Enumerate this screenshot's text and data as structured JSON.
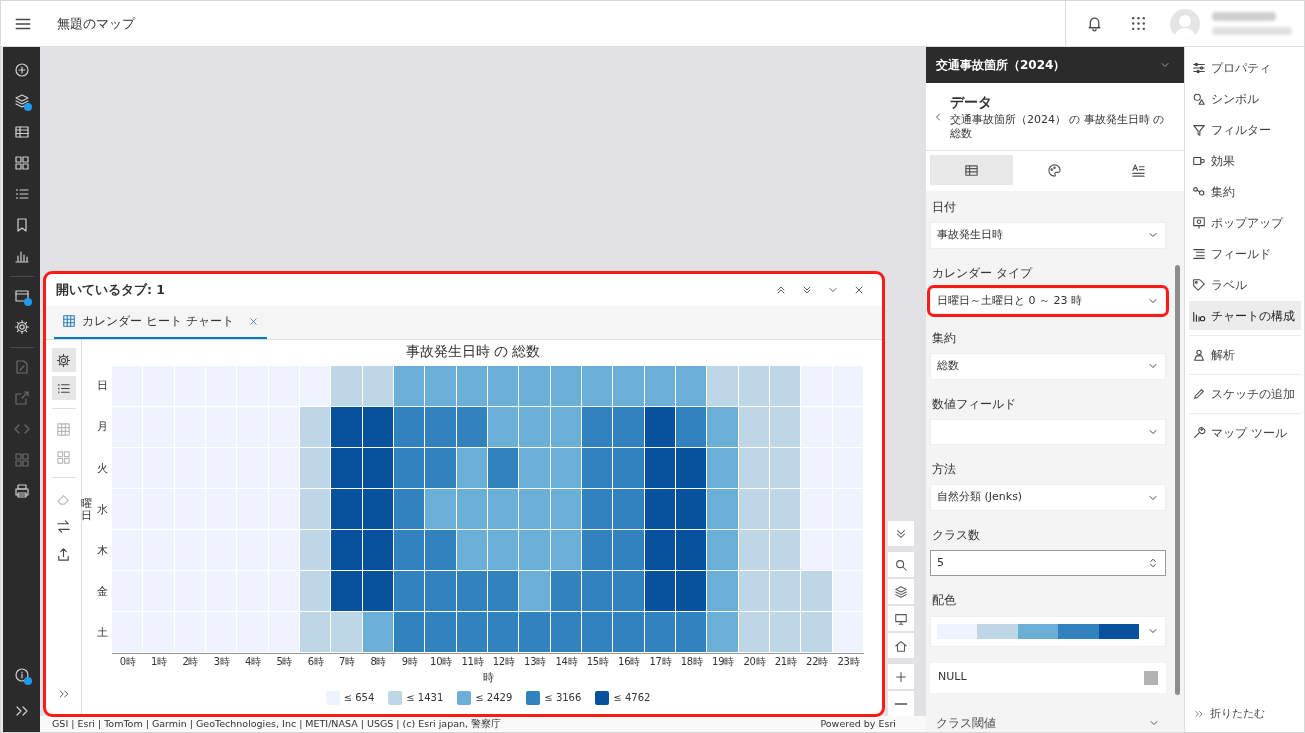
{
  "top_bar": {
    "title": "無題のマップ"
  },
  "left_rail": {
    "groups": [
      [
        {
          "badge": false,
          "disabled": false
        },
        {
          "badge": true,
          "disabled": false
        },
        {
          "badge": false,
          "disabled": false
        },
        {
          "badge": false,
          "disabled": false
        },
        {
          "badge": false,
          "disabled": false
        },
        {
          "badge": false,
          "disabled": false
        },
        {
          "badge": false,
          "disabled": false
        }
      ],
      [
        {
          "badge": true,
          "disabled": false
        },
        {
          "badge": false,
          "disabled": false
        }
      ],
      [
        {
          "badge": false,
          "disabled": true
        },
        {
          "badge": false,
          "disabled": true
        },
        {
          "badge": false,
          "disabled": true
        },
        {
          "badge": false,
          "disabled": true
        },
        {
          "badge": false,
          "disabled": false
        }
      ]
    ],
    "bottom": [
      {
        "badge": true,
        "disabled": false
      },
      {
        "badge": false,
        "disabled": false
      }
    ]
  },
  "map": {
    "attribution": "GSI | Esri | TomTom | Garmin | GeoTechnologies, Inc | METI/NASA | USGS | (c) Esri japan, 警察庁",
    "powered_by": "Powered by Esri"
  },
  "chart_panel": {
    "highlighted": true,
    "title": "開いているタブ: 1",
    "tabs": [
      {
        "label": "カレンダー ヒート チャート",
        "selected": true
      }
    ],
    "tools": [
      [
        {
          "selected": true,
          "disabled": false
        },
        {
          "selected": true,
          "disabled": false
        }
      ],
      [
        {
          "selected": false,
          "disabled": true
        },
        {
          "selected": false,
          "disabled": true
        }
      ],
      [
        {
          "selected": false,
          "disabled": true
        },
        {
          "selected": false,
          "disabled": false
        },
        {
          "selected": false,
          "disabled": false
        }
      ]
    ],
    "chart": {
      "title": "事故発生日時 の 総数",
      "ylabel": "曜日",
      "xlabel": "時",
      "columns": [
        "0時",
        "1時",
        "2時",
        "3時",
        "4時",
        "5時",
        "6時",
        "7時",
        "8時",
        "9時",
        "10時",
        "11時",
        "12時",
        "13時",
        "14時",
        "15時",
        "16時",
        "17時",
        "18時",
        "19時",
        "20時",
        "21時",
        "22時",
        "23時"
      ],
      "rows": [
        {
          "label": "日",
          "cells": [
            {
              "color": "#eff3ff"
            },
            {
              "color": "#eff3ff"
            },
            {
              "color": "#eff3ff"
            },
            {
              "color": "#eff3ff"
            },
            {
              "color": "#eff3ff"
            },
            {
              "color": "#eff3ff"
            },
            {
              "color": "#eff3ff"
            },
            {
              "color": "#bdd7e7"
            },
            {
              "color": "#bdd7e7"
            },
            {
              "color": "#6baed6"
            },
            {
              "color": "#6baed6"
            },
            {
              "color": "#6baed6"
            },
            {
              "color": "#6baed6"
            },
            {
              "color": "#6baed6"
            },
            {
              "color": "#6baed6"
            },
            {
              "color": "#6baed6"
            },
            {
              "color": "#6baed6"
            },
            {
              "color": "#6baed6"
            },
            {
              "color": "#6baed6"
            },
            {
              "color": "#bdd7e7"
            },
            {
              "color": "#bdd7e7"
            },
            {
              "color": "#bdd7e7"
            },
            {
              "color": "#eff3ff"
            },
            {
              "color": "#eff3ff"
            }
          ]
        },
        {
          "label": "月",
          "cells": [
            {
              "color": "#eff3ff"
            },
            {
              "color": "#eff3ff"
            },
            {
              "color": "#eff3ff"
            },
            {
              "color": "#eff3ff"
            },
            {
              "color": "#eff3ff"
            },
            {
              "color": "#eff3ff"
            },
            {
              "color": "#bdd7e7"
            },
            {
              "color": "#08519c"
            },
            {
              "color": "#08519c"
            },
            {
              "color": "#3182bd"
            },
            {
              "color": "#3182bd"
            },
            {
              "color": "#3182bd"
            },
            {
              "color": "#6baed6"
            },
            {
              "color": "#6baed6"
            },
            {
              "color": "#6baed6"
            },
            {
              "color": "#3182bd"
            },
            {
              "color": "#3182bd"
            },
            {
              "color": "#08519c"
            },
            {
              "color": "#3182bd"
            },
            {
              "color": "#6baed6"
            },
            {
              "color": "#bdd7e7"
            },
            {
              "color": "#bdd7e7"
            },
            {
              "color": "#eff3ff"
            },
            {
              "color": "#eff3ff"
            }
          ]
        },
        {
          "label": "火",
          "cells": [
            {
              "color": "#eff3ff"
            },
            {
              "color": "#eff3ff"
            },
            {
              "color": "#eff3ff"
            },
            {
              "color": "#eff3ff"
            },
            {
              "color": "#eff3ff"
            },
            {
              "color": "#eff3ff"
            },
            {
              "color": "#bdd7e7"
            },
            {
              "color": "#08519c"
            },
            {
              "color": "#08519c"
            },
            {
              "color": "#3182bd"
            },
            {
              "color": "#3182bd"
            },
            {
              "color": "#6baed6"
            },
            {
              "color": "#3182bd"
            },
            {
              "color": "#6baed6"
            },
            {
              "color": "#6baed6"
            },
            {
              "color": "#3182bd"
            },
            {
              "color": "#3182bd"
            },
            {
              "color": "#08519c"
            },
            {
              "color": "#08519c"
            },
            {
              "color": "#6baed6"
            },
            {
              "color": "#bdd7e7"
            },
            {
              "color": "#bdd7e7"
            },
            {
              "color": "#eff3ff"
            },
            {
              "color": "#eff3ff"
            }
          ]
        },
        {
          "label": "水",
          "cells": [
            {
              "color": "#eff3ff"
            },
            {
              "color": "#eff3ff"
            },
            {
              "color": "#eff3ff"
            },
            {
              "color": "#eff3ff"
            },
            {
              "color": "#eff3ff"
            },
            {
              "color": "#eff3ff"
            },
            {
              "color": "#bdd7e7"
            },
            {
              "color": "#08519c"
            },
            {
              "color": "#08519c"
            },
            {
              "color": "#3182bd"
            },
            {
              "color": "#6baed6"
            },
            {
              "color": "#6baed6"
            },
            {
              "color": "#6baed6"
            },
            {
              "color": "#6baed6"
            },
            {
              "color": "#6baed6"
            },
            {
              "color": "#3182bd"
            },
            {
              "color": "#3182bd"
            },
            {
              "color": "#08519c"
            },
            {
              "color": "#08519c"
            },
            {
              "color": "#6baed6"
            },
            {
              "color": "#bdd7e7"
            },
            {
              "color": "#bdd7e7"
            },
            {
              "color": "#eff3ff"
            },
            {
              "color": "#eff3ff"
            }
          ]
        },
        {
          "label": "木",
          "cells": [
            {
              "color": "#eff3ff"
            },
            {
              "color": "#eff3ff"
            },
            {
              "color": "#eff3ff"
            },
            {
              "color": "#eff3ff"
            },
            {
              "color": "#eff3ff"
            },
            {
              "color": "#eff3ff"
            },
            {
              "color": "#bdd7e7"
            },
            {
              "color": "#08519c"
            },
            {
              "color": "#08519c"
            },
            {
              "color": "#3182bd"
            },
            {
              "color": "#3182bd"
            },
            {
              "color": "#6baed6"
            },
            {
              "color": "#6baed6"
            },
            {
              "color": "#6baed6"
            },
            {
              "color": "#6baed6"
            },
            {
              "color": "#3182bd"
            },
            {
              "color": "#3182bd"
            },
            {
              "color": "#08519c"
            },
            {
              "color": "#08519c"
            },
            {
              "color": "#6baed6"
            },
            {
              "color": "#bdd7e7"
            },
            {
              "color": "#bdd7e7"
            },
            {
              "color": "#eff3ff"
            },
            {
              "color": "#eff3ff"
            }
          ]
        },
        {
          "label": "金",
          "cells": [
            {
              "color": "#eff3ff"
            },
            {
              "color": "#eff3ff"
            },
            {
              "color": "#eff3ff"
            },
            {
              "color": "#eff3ff"
            },
            {
              "color": "#eff3ff"
            },
            {
              "color": "#eff3ff"
            },
            {
              "color": "#bdd7e7"
            },
            {
              "color": "#08519c"
            },
            {
              "color": "#08519c"
            },
            {
              "color": "#3182bd"
            },
            {
              "color": "#3182bd"
            },
            {
              "color": "#3182bd"
            },
            {
              "color": "#3182bd"
            },
            {
              "color": "#6baed6"
            },
            {
              "color": "#3182bd"
            },
            {
              "color": "#3182bd"
            },
            {
              "color": "#3182bd"
            },
            {
              "color": "#08519c"
            },
            {
              "color": "#08519c"
            },
            {
              "color": "#6baed6"
            },
            {
              "color": "#bdd7e7"
            },
            {
              "color": "#bdd7e7"
            },
            {
              "color": "#bdd7e7"
            },
            {
              "color": "#eff3ff"
            }
          ]
        },
        {
          "label": "土",
          "cells": [
            {
              "color": "#eff3ff"
            },
            {
              "color": "#eff3ff"
            },
            {
              "color": "#eff3ff"
            },
            {
              "color": "#eff3ff"
            },
            {
              "color": "#eff3ff"
            },
            {
              "color": "#eff3ff"
            },
            {
              "color": "#bdd7e7"
            },
            {
              "color": "#bdd7e7"
            },
            {
              "color": "#6baed6"
            },
            {
              "color": "#3182bd"
            },
            {
              "color": "#3182bd"
            },
            {
              "color": "#3182bd"
            },
            {
              "color": "#3182bd"
            },
            {
              "color": "#3182bd"
            },
            {
              "color": "#3182bd"
            },
            {
              "color": "#3182bd"
            },
            {
              "color": "#3182bd"
            },
            {
              "color": "#3182bd"
            },
            {
              "color": "#3182bd"
            },
            {
              "color": "#6baed6"
            },
            {
              "color": "#bdd7e7"
            },
            {
              "color": "#bdd7e7"
            },
            {
              "color": "#bdd7e7"
            },
            {
              "color": "#eff3ff"
            }
          ]
        }
      ],
      "legend": [
        {
          "label": "≤ 654",
          "color": "#eff3ff"
        },
        {
          "label": "≤ 1431",
          "color": "#bdd7e7"
        },
        {
          "label": "≤ 2429",
          "color": "#6baed6"
        },
        {
          "label": "≤ 3166",
          "color": "#3182bd"
        },
        {
          "label": "≤ 4762",
          "color": "#08519c"
        }
      ]
    }
  },
  "data_panel": {
    "layer": "交通事故箇所（2024）",
    "title": "データ",
    "subtitle": "交通事故箇所（2024） の 事故発生日時 の総数",
    "tabs": [
      {
        "selected": true
      },
      {
        "selected": false
      },
      {
        "selected": false
      }
    ],
    "fields": [
      {
        "kind": "select",
        "label": "日付",
        "value": "事故発生日時",
        "highlighted": false
      },
      {
        "kind": "select",
        "label": "カレンダー タイプ",
        "value": "日曜日～土曜日と 0 ～ 23 時",
        "highlighted": true
      },
      {
        "kind": "select",
        "label": "集約",
        "value": "総数",
        "highlighted": false
      },
      {
        "kind": "select",
        "label": "数値フィールド",
        "highlighted": false
      },
      {
        "kind": "select",
        "label": "方法",
        "value": "自然分類 (Jenks)",
        "highlighted": false
      },
      {
        "kind": "number",
        "label": "クラス数",
        "value": "5",
        "highlighted": false
      },
      {
        "kind": "ramp",
        "label": "配色",
        "colors": [
          {
            "color": "#eff3ff"
          },
          {
            "color": "#bdd7e7"
          },
          {
            "color": "#6baed6"
          },
          {
            "color": "#3182bd"
          },
          {
            "color": "#08519c"
          }
        ],
        "highlighted": false
      },
      {
        "kind": "null",
        "label": "NULL",
        "highlighted": false
      },
      {
        "kind": "section",
        "label": "クラス閾値",
        "expanded": false,
        "highlighted": false
      }
    ]
  },
  "settings_rail": {
    "groups": [
      [
        {
          "label": "プロパティ",
          "selected": false
        },
        {
          "label": "シンボル",
          "selected": false
        },
        {
          "label": "フィルター",
          "selected": false
        },
        {
          "label": "効果",
          "selected": false
        },
        {
          "label": "集約",
          "selected": false
        },
        {
          "label": "ポップアップ",
          "selected": false
        },
        {
          "label": "フィールド",
          "selected": false
        },
        {
          "label": "ラベル",
          "selected": false
        },
        {
          "label": "チャートの構成",
          "selected": true
        }
      ],
      [
        {
          "label": "解析",
          "selected": false
        }
      ],
      [
        {
          "label": "スケッチの追加",
          "selected": false
        }
      ],
      [
        {
          "label": "マップ ツール",
          "selected": false
        }
      ]
    ],
    "collapse": "折りたたむ"
  }
}
